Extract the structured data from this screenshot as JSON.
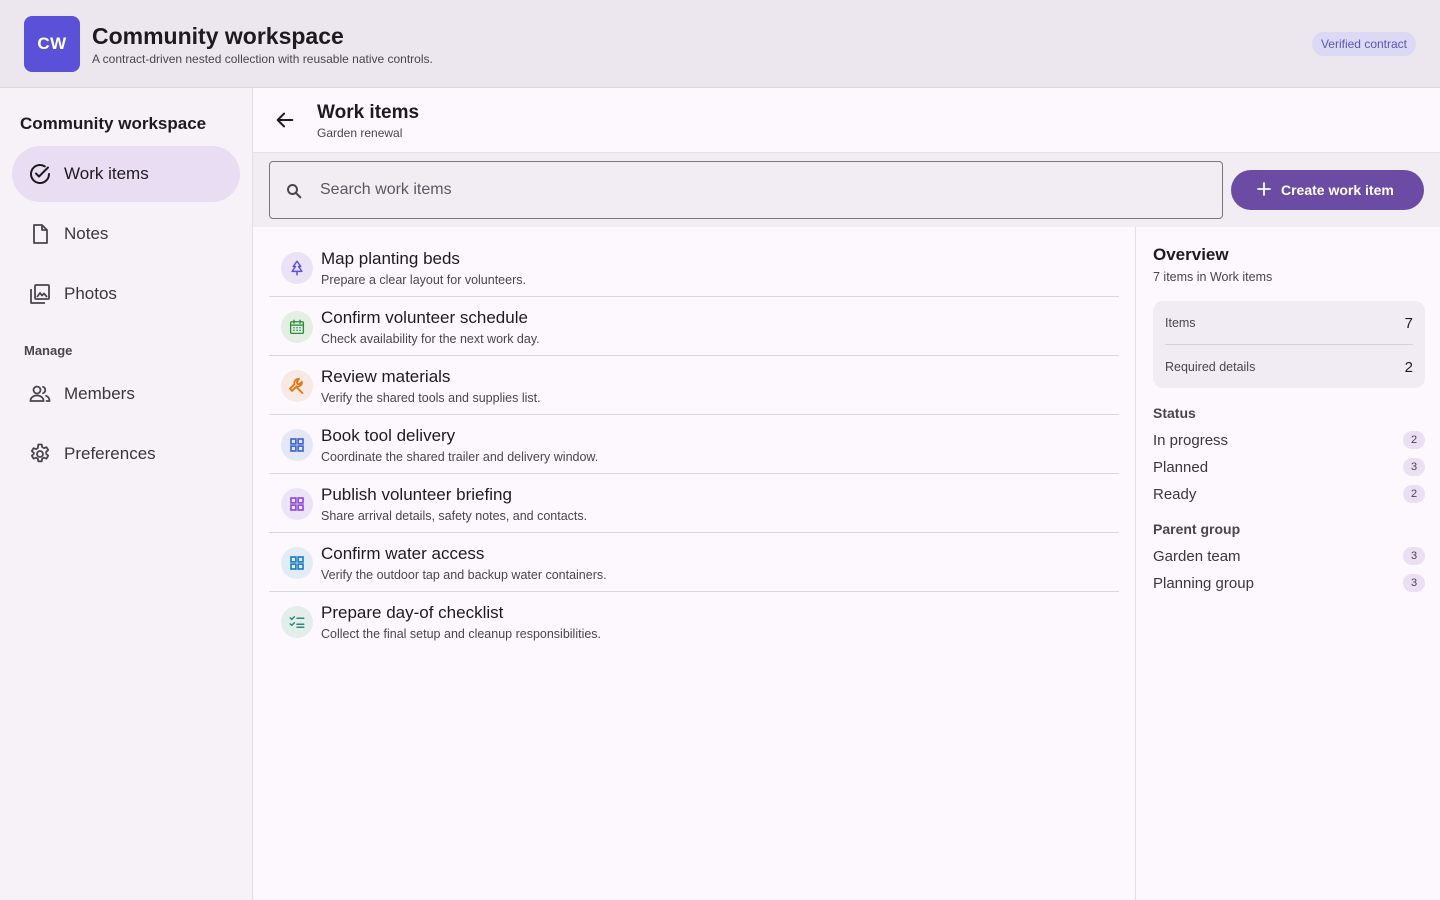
{
  "app": {
    "logo_text": "CW",
    "title": "Community workspace",
    "subtitle": "A contract-driven nested collection with reusable native controls.",
    "badge": "Verified contract"
  },
  "sidebar": {
    "title": "Community workspace",
    "items": [
      {
        "label": "Work items",
        "icon": "check-circle-icon",
        "active": true
      },
      {
        "label": "Notes",
        "icon": "document-icon",
        "active": false
      },
      {
        "label": "Photos",
        "icon": "photo-library-icon",
        "active": false
      }
    ],
    "manage_label": "Manage",
    "manage_items": [
      {
        "label": "Members",
        "icon": "people-icon"
      },
      {
        "label": "Preferences",
        "icon": "gear-icon"
      }
    ]
  },
  "header": {
    "title": "Work items",
    "subtitle": "Garden renewal"
  },
  "search": {
    "placeholder": "Search work items",
    "value": ""
  },
  "create_button": {
    "label": "Create work item"
  },
  "work_items": [
    {
      "title": "Map planting beds",
      "description": "Prepare a clear layout for volunteers.",
      "icon": "tree-icon",
      "color": "#5b51d8"
    },
    {
      "title": "Confirm volunteer schedule",
      "description": "Check availability for the next work day.",
      "icon": "calendar-icon",
      "color": "#2e8b3c"
    },
    {
      "title": "Review materials",
      "description": "Verify the shared tools and supplies list.",
      "icon": "wrench-icon",
      "color": "#e07b12"
    },
    {
      "title": "Book tool delivery",
      "description": "Coordinate the shared trailer and delivery window.",
      "icon": "grid-icon",
      "color": "#3a64d8"
    },
    {
      "title": "Publish volunteer briefing",
      "description": "Share arrival details, safety notes, and contacts.",
      "icon": "grid-icon",
      "color": "#8a4ad8"
    },
    {
      "title": "Confirm water access",
      "description": "Verify the outdoor tap and backup water containers.",
      "icon": "grid-icon",
      "color": "#1b7ec8"
    },
    {
      "title": "Prepare day-of checklist",
      "description": "Collect the final setup and cleanup responsibilities.",
      "icon": "checklist-icon",
      "color": "#2a8c78"
    }
  ],
  "overview": {
    "title": "Overview",
    "subtitle": "7 items in Work items",
    "stats": [
      {
        "label": "Items",
        "value": "7"
      },
      {
        "label": "Required details",
        "value": "2"
      }
    ],
    "status_label": "Status",
    "status": [
      {
        "label": "In progress",
        "count": "2"
      },
      {
        "label": "Planned",
        "count": "3"
      },
      {
        "label": "Ready",
        "count": "2"
      }
    ],
    "parent_label": "Parent group",
    "parents": [
      {
        "label": "Garden team",
        "count": "3"
      },
      {
        "label": "Planning group",
        "count": "3"
      }
    ]
  }
}
